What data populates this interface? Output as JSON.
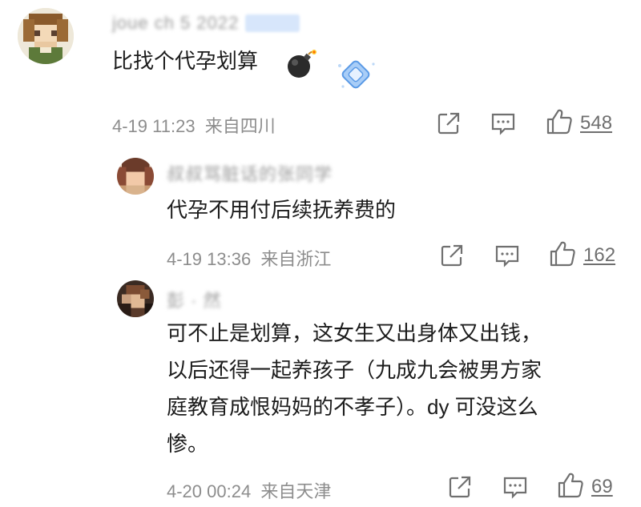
{
  "comments": [
    {
      "username": "joue ch 5 2022",
      "text": "比找个代孕划算",
      "time": "4-19 11:23",
      "location": "来自四川",
      "likes": "548",
      "emoji": "bomb-emoji",
      "sticker": "diamond-sticker"
    },
    {
      "username": "叔叔骂脏话的张同学",
      "text": "代孕不用付后续抚养费的",
      "time": "4-19 13:36",
      "location": "来自浙江",
      "likes": "162"
    },
    {
      "username": "彭 · 然",
      "text_lines": [
        "可不止是划算，这女生又出身体又出钱，",
        "以后还得一起养孩子（九成九会被男方家",
        "庭教育成恨妈妈的不孝子）。dy 可没这么",
        "惨。"
      ],
      "time": "4-20 00:24",
      "location": "来自天津",
      "likes": "69"
    }
  ],
  "icons": {
    "share": "share-icon",
    "comment": "comment-icon",
    "like": "thumbs-up-icon"
  },
  "colors": {
    "meta": "#8d8d8d",
    "icon": "#707070",
    "sticker": "#6aa8ef"
  }
}
